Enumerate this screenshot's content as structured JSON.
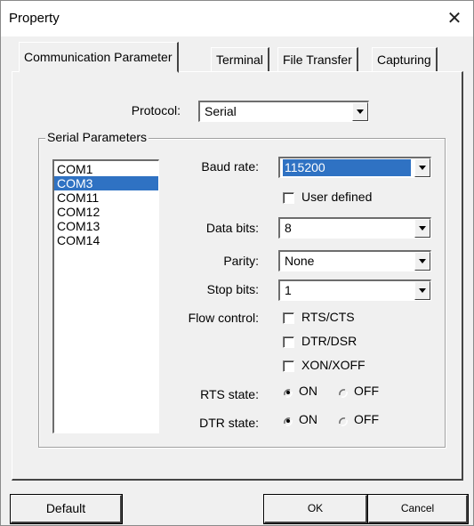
{
  "window": {
    "title": "Property",
    "close_glyph": "✕"
  },
  "tabs": [
    {
      "label": "Communication Parameter",
      "active": true
    },
    {
      "label": "Terminal"
    },
    {
      "label": "File Transfer"
    },
    {
      "label": "Capturing"
    }
  ],
  "protocol": {
    "label": "Protocol:",
    "value": "Serial"
  },
  "serial": {
    "legend": "Serial Parameters",
    "ports": [
      "COM1",
      "COM3",
      "COM11",
      "COM12",
      "COM13",
      "COM14"
    ],
    "selected_port": "COM3",
    "baud": {
      "label": "Baud rate:",
      "value": "115200"
    },
    "user_defined": {
      "label": "User defined",
      "checked": false
    },
    "data_bits": {
      "label": "Data bits:",
      "value": "8"
    },
    "parity": {
      "label": "Parity:",
      "value": "None"
    },
    "stop_bits": {
      "label": "Stop bits:",
      "value": "1"
    },
    "flow_control": {
      "label": "Flow control:",
      "options": [
        {
          "label": "RTS/CTS",
          "checked": false
        },
        {
          "label": "DTR/DSR",
          "checked": false
        },
        {
          "label": "XON/XOFF",
          "checked": false
        }
      ]
    },
    "rts_state": {
      "label": "RTS state:",
      "on": "ON",
      "off": "OFF",
      "selected": "ON"
    },
    "dtr_state": {
      "label": "DTR state:",
      "on": "ON",
      "off": "OFF",
      "selected": "ON"
    }
  },
  "buttons": {
    "default": "Default",
    "ok": "OK",
    "cancel": "Cancel"
  },
  "colors": {
    "selection": "#2f72c3",
    "face": "#f0f0f0"
  }
}
